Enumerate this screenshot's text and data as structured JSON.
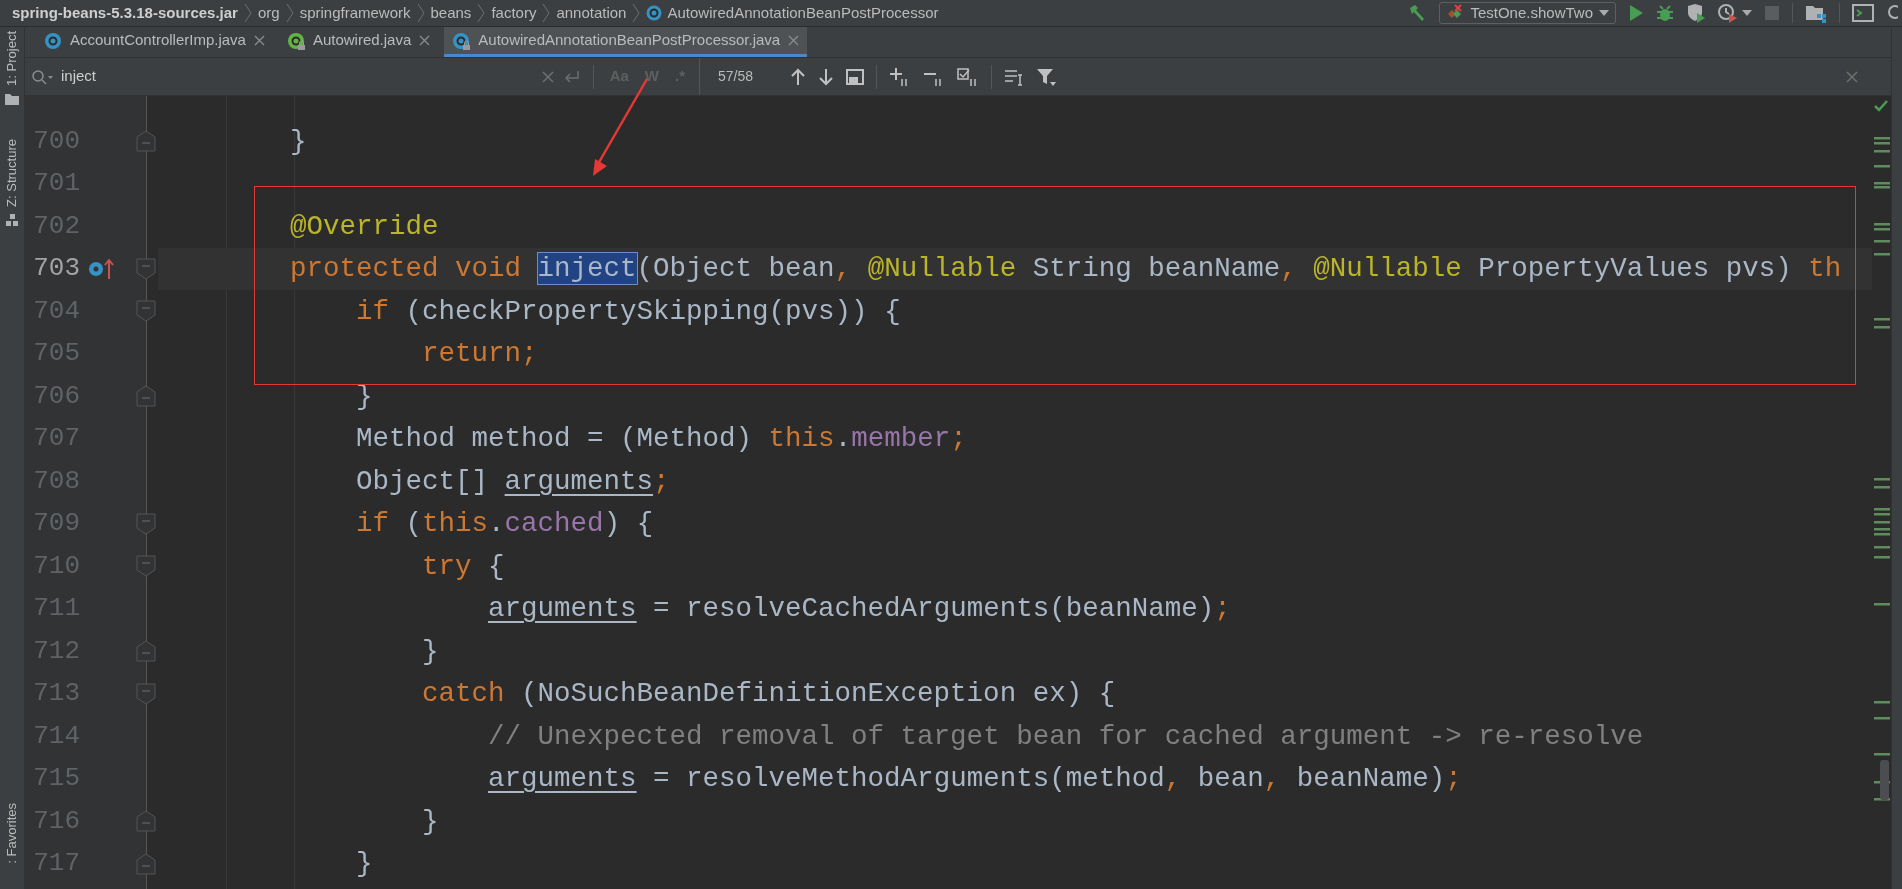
{
  "breadcrumbs": [
    {
      "label": "spring-beans-5.3.18-sources.jar",
      "kind": "jar"
    },
    {
      "label": "org",
      "kind": "package"
    },
    {
      "label": "springframework",
      "kind": "package"
    },
    {
      "label": "beans",
      "kind": "package"
    },
    {
      "label": "factory",
      "kind": "package"
    },
    {
      "label": "annotation",
      "kind": "package"
    },
    {
      "label": "AutowiredAnnotationBeanPostProcessor",
      "kind": "class"
    }
  ],
  "run_config": {
    "label": "TestOne.showTwo"
  },
  "tabs": [
    {
      "label": "AccountControllerImp.java",
      "kind": "class",
      "locked": false,
      "selected": false
    },
    {
      "label": "Autowired.java",
      "kind": "annotation",
      "locked": true,
      "selected": false
    },
    {
      "label": "AutowiredAnnotationBeanPostProcessor.java",
      "kind": "class",
      "locked": true,
      "selected": true
    }
  ],
  "tool_windows_left": [
    {
      "label": "1: Project",
      "kind": "project"
    },
    {
      "label": "Z: Structure",
      "kind": "structure"
    },
    {
      "label": ": Favorites",
      "kind": "favorites"
    }
  ],
  "find": {
    "query": "inject",
    "count": "57/58",
    "options": [
      {
        "label": "Aa",
        "on": false
      },
      {
        "label": "W",
        "on": false
      },
      {
        "label": ".*",
        "on": false
      }
    ]
  },
  "lines": [
    {
      "number": "700",
      "fold": {
        "kind": "end"
      },
      "current": false,
      "tokens": [
        {
          "text": "        }",
          "kind": "plain"
        }
      ]
    },
    {
      "number": "701",
      "current": false
    },
    {
      "number": "702",
      "current": false,
      "tokens": [
        {
          "text": "        @Override",
          "kind": "annotation"
        }
      ]
    },
    {
      "number": "703",
      "fold": {
        "kind": "start"
      },
      "current": true,
      "marker": {
        "kind": "overrides"
      },
      "tokens": [
        {
          "text": "        protected void ",
          "kind": "keyword"
        },
        {
          "text": "inject",
          "kind": "match"
        },
        {
          "text": "(Object bean",
          "kind": "plain"
        },
        {
          "text": ", ",
          "kind": "keyword"
        },
        {
          "text": "@Nullable",
          "kind": "annotation"
        },
        {
          "text": " String beanName",
          "kind": "plain"
        },
        {
          "text": ", ",
          "kind": "keyword"
        },
        {
          "text": "@Nullable",
          "kind": "annotation"
        },
        {
          "text": " PropertyValues pvs) ",
          "kind": "plain"
        },
        {
          "text": "th",
          "kind": "keyword"
        }
      ]
    },
    {
      "number": "704",
      "fold": {
        "kind": "start"
      },
      "current": false,
      "tokens": [
        {
          "text": "            if",
          "kind": "keyword"
        },
        {
          "text": " (checkPropertySkipping(pvs)) {",
          "kind": "plain"
        }
      ]
    },
    {
      "number": "705",
      "current": false,
      "tokens": [
        {
          "text": "                return;",
          "kind": "keyword"
        }
      ]
    },
    {
      "number": "706",
      "fold": {
        "kind": "end"
      },
      "current": false,
      "tokens": [
        {
          "text": "            }",
          "kind": "plain"
        }
      ]
    },
    {
      "number": "707",
      "current": false,
      "tokens": [
        {
          "text": "            Method method = (Method) ",
          "kind": "plain"
        },
        {
          "text": "this",
          "kind": "keyword"
        },
        {
          "text": ".",
          "kind": "plain"
        },
        {
          "text": "member",
          "kind": "field"
        },
        {
          "text": ";",
          "kind": "keyword"
        }
      ]
    },
    {
      "number": "708",
      "current": false,
      "tokens": [
        {
          "text": "            Object[] ",
          "kind": "plain"
        },
        {
          "text": "arguments",
          "kind": "var"
        },
        {
          "text": ";",
          "kind": "keyword"
        }
      ]
    },
    {
      "number": "709",
      "fold": {
        "kind": "start"
      },
      "current": false,
      "tokens": [
        {
          "text": "            if",
          "kind": "keyword"
        },
        {
          "text": " (",
          "kind": "plain"
        },
        {
          "text": "this",
          "kind": "keyword"
        },
        {
          "text": ".",
          "kind": "plain"
        },
        {
          "text": "cached",
          "kind": "field"
        },
        {
          "text": ") {",
          "kind": "plain"
        }
      ]
    },
    {
      "number": "710",
      "fold": {
        "kind": "start"
      },
      "current": false,
      "tokens": [
        {
          "text": "                try",
          "kind": "keyword"
        },
        {
          "text": " {",
          "kind": "plain"
        }
      ]
    },
    {
      "number": "711",
      "current": false,
      "tokens": [
        {
          "text": "                    arguments",
          "kind": "var"
        },
        {
          "text": " = resolveCachedArguments(beanName)",
          "kind": "plain"
        },
        {
          "text": ";",
          "kind": "keyword"
        }
      ]
    },
    {
      "number": "712",
      "fold": {
        "kind": "end"
      },
      "current": false,
      "tokens": [
        {
          "text": "                }",
          "kind": "plain"
        }
      ]
    },
    {
      "number": "713",
      "fold": {
        "kind": "start"
      },
      "current": false,
      "tokens": [
        {
          "text": "                catch",
          "kind": "keyword"
        },
        {
          "text": " (NoSuchBeanDefinitionException ex) {",
          "kind": "plain"
        }
      ]
    },
    {
      "number": "714",
      "current": false,
      "tokens": [
        {
          "text": "                    // Unexpected removal of target bean for cached argument -> re-resolve",
          "kind": "comment"
        }
      ]
    },
    {
      "number": "715",
      "current": false,
      "tokens": [
        {
          "text": "                    arguments",
          "kind": "var"
        },
        {
          "text": " = resolveMethodArguments(method",
          "kind": "plain"
        },
        {
          "text": ", ",
          "kind": "keyword"
        },
        {
          "text": "bean",
          "kind": "plain"
        },
        {
          "text": ", ",
          "kind": "keyword"
        },
        {
          "text": "beanName)",
          "kind": "plain"
        },
        {
          "text": ";",
          "kind": "keyword"
        }
      ]
    },
    {
      "number": "716",
      "fold": {
        "kind": "end"
      },
      "current": false,
      "tokens": [
        {
          "text": "                }",
          "kind": "plain"
        }
      ]
    },
    {
      "number": "717",
      "fold": {
        "kind": "end"
      },
      "current": false,
      "tokens": [
        {
          "text": "            }",
          "kind": "plain"
        }
      ]
    }
  ]
}
